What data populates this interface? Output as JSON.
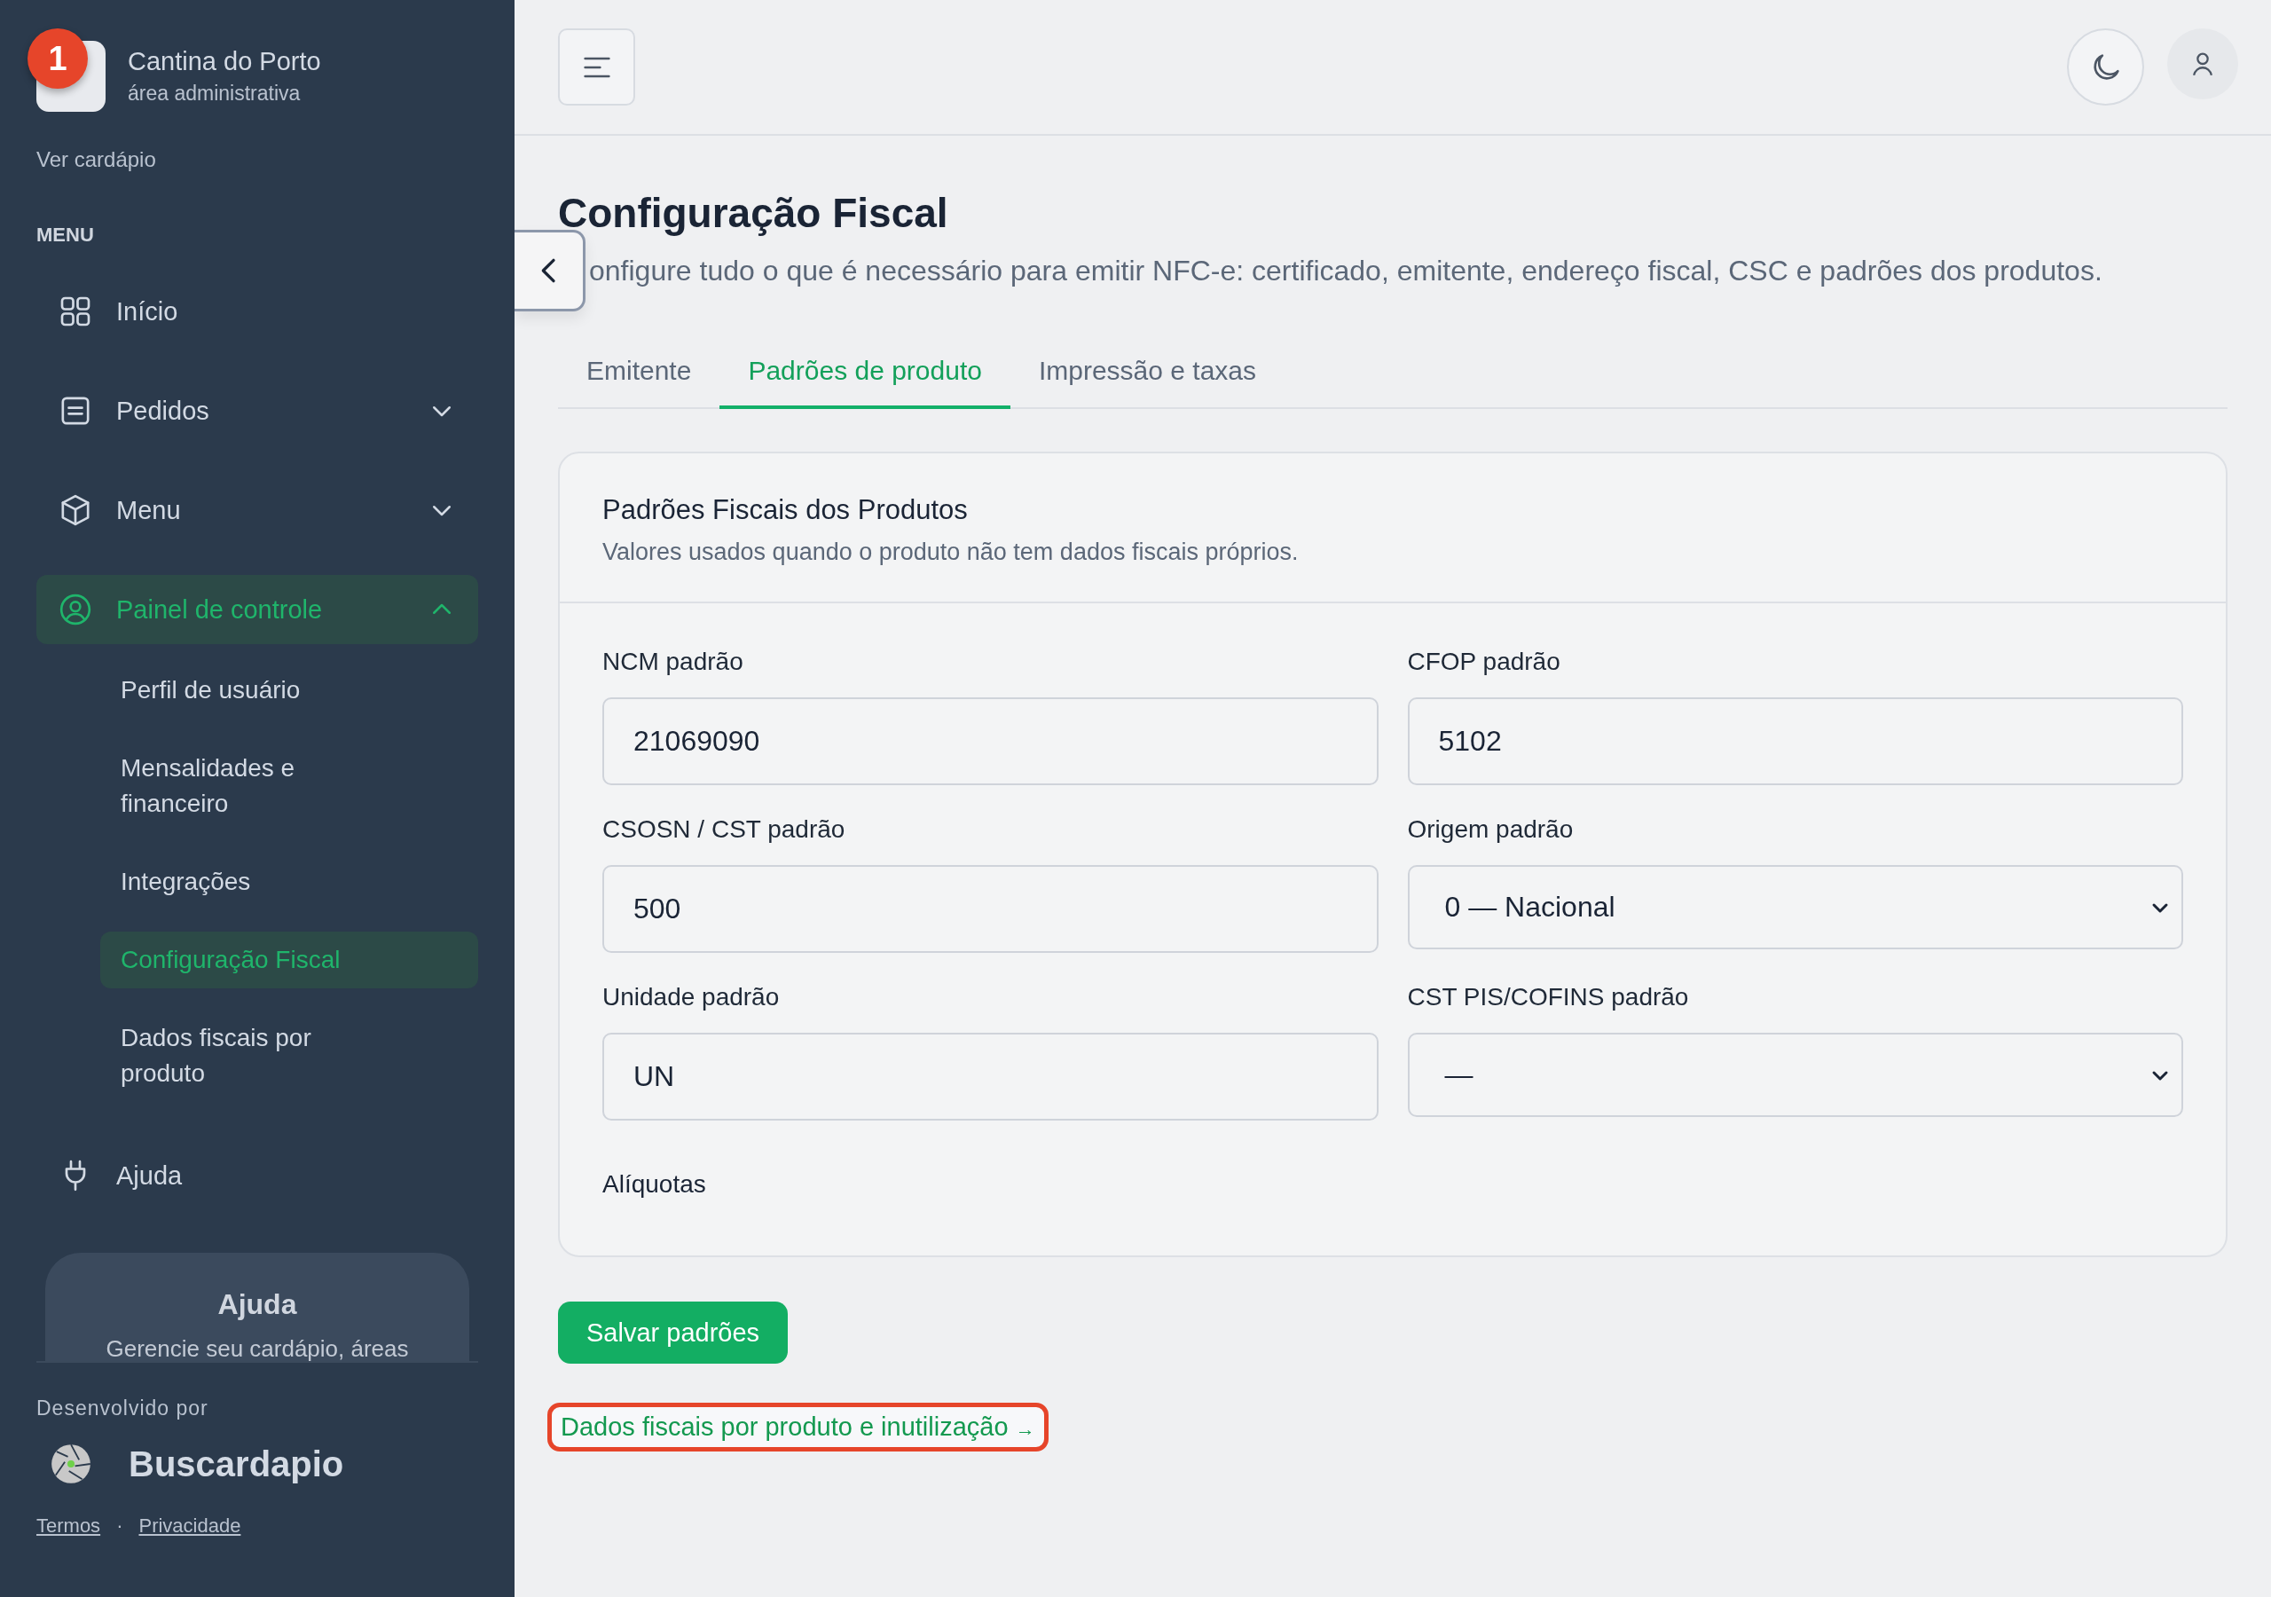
{
  "sidebar": {
    "brand": {
      "badge": "1",
      "name": "Cantina do Porto",
      "subtitle": "área administrativa"
    },
    "view_menu_link": "Ver cardápio",
    "section_label": "MENU",
    "items": [
      {
        "label": "Início",
        "selected": false
      },
      {
        "label": "Pedidos",
        "expanded": false,
        "selected": false
      },
      {
        "label": "Menu",
        "expanded": false,
        "selected": false
      },
      {
        "label": "Painel de controle",
        "expanded": true,
        "selected": true,
        "children": [
          {
            "label": "Perfil de usuário",
            "selected": false
          },
          {
            "label": "Mensalidades e financeiro",
            "selected": false
          },
          {
            "label": "Integrações",
            "selected": false
          },
          {
            "label": "Configuração Fiscal",
            "selected": true
          },
          {
            "label": "Dados fiscais por produto",
            "selected": false
          }
        ]
      },
      {
        "label": "Ajuda",
        "selected": false
      }
    ],
    "help_card": {
      "title": "Ajuda",
      "text": "Gerencie seu cardápio, áreas"
    },
    "footer": {
      "credit": "Desenvolvido por",
      "brand": "Buscardapio",
      "links": [
        "Termos",
        "Privacidade"
      ],
      "separator": "·"
    }
  },
  "page": {
    "title": "Configuração Fiscal",
    "subtitle": "onfigure tudo o que é necessário para emitir NFC-e: certificado, emitente, endereço fiscal, CSC e padrões dos produtos.",
    "tabs": [
      {
        "label": "Emitente",
        "selected": false
      },
      {
        "label": "Padrões de produto",
        "selected": true
      },
      {
        "label": "Impressão e taxas",
        "selected": false
      }
    ],
    "card": {
      "title": "Padrões Fiscais dos Produtos",
      "description": "Valores usados quando o produto não tem dados fiscais próprios.",
      "fields": [
        {
          "label": "NCM padrão",
          "kind": "input",
          "value": "21069090"
        },
        {
          "label": "CFOP padrão",
          "kind": "input",
          "value": "5102"
        },
        {
          "label": "CSOSN / CST padrão",
          "kind": "input",
          "value": "500"
        },
        {
          "label": "Origem padrão",
          "kind": "select",
          "value": "0 — Nacional"
        },
        {
          "label": "Unidade padrão",
          "kind": "input",
          "value": "UN"
        },
        {
          "label": "CST PIS/COFINS padrão",
          "kind": "select",
          "value": "—"
        }
      ],
      "section_label": "Alíquotas"
    },
    "save_button": "Salvar padrões",
    "link": {
      "label": "Dados fiscais por produto e inutilização",
      "arrow": "→",
      "highlighted": true
    }
  }
}
